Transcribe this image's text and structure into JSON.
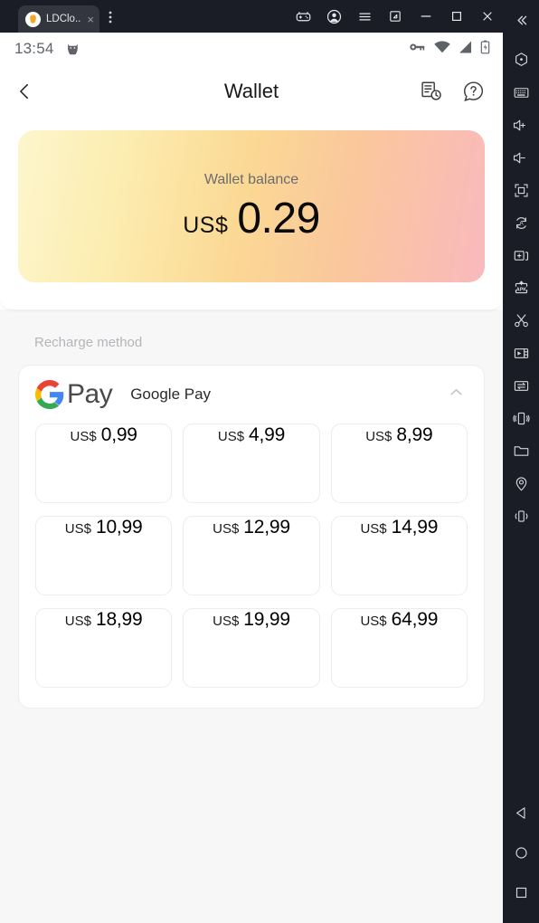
{
  "window": {
    "tab": {
      "label": "LDClo...",
      "icon": "app-icon",
      "close": "×"
    },
    "tab_menu_icon": "kebab-menu-icon",
    "controls": [
      {
        "name": "gamepad-icon",
        "tooltip": "Game controls"
      },
      {
        "name": "account-icon",
        "tooltip": "Account"
      },
      {
        "name": "menu-icon",
        "tooltip": "Menu"
      },
      {
        "name": "resize-icon",
        "tooltip": "Resize"
      },
      {
        "name": "minimize-icon",
        "tooltip": "Minimize"
      },
      {
        "name": "maximize-icon",
        "tooltip": "Maximize"
      },
      {
        "name": "close-icon",
        "tooltip": "Close"
      },
      {
        "name": "collapse-icon",
        "tooltip": "Collapse sidebar"
      }
    ]
  },
  "statusbar": {
    "time": "13:54",
    "left_icon": "cat-icon",
    "right_icons": [
      "vpn-key-icon",
      "wifi-icon",
      "signal-icon",
      "battery-charging-icon"
    ]
  },
  "appbar": {
    "back_icon": "chevron-left-icon",
    "title": "Wallet",
    "actions": [
      {
        "name": "transaction-history-icon"
      },
      {
        "name": "help-icon"
      }
    ]
  },
  "balance": {
    "label": "Wallet balance",
    "currency": "US$",
    "amount": "0.29",
    "gradient_from": "#fdf6cd",
    "gradient_to": "#f9b9bd"
  },
  "recharge": {
    "section_label": "Recharge method",
    "method": {
      "logo": "google-pay-logo",
      "logo_word": "Pay",
      "name": "Google Pay",
      "collapse_icon": "chevron-up-icon",
      "expanded": true
    },
    "currency": "US$",
    "amounts": [
      "0,99",
      "4,99",
      "8,99",
      "10,99",
      "12,99",
      "14,99",
      "18,99",
      "19,99",
      "64,99"
    ]
  },
  "sidebar": {
    "items": [
      {
        "name": "record-macro-icon"
      },
      {
        "name": "keyboard-icon"
      },
      {
        "name": "volume-up-icon"
      },
      {
        "name": "volume-down-icon"
      },
      {
        "name": "fullscreen-icon"
      },
      {
        "name": "auto-rotate-icon"
      },
      {
        "name": "add-window-icon"
      },
      {
        "name": "install-apk-icon"
      },
      {
        "name": "screenshot-icon"
      },
      {
        "name": "video-record-icon"
      },
      {
        "name": "file-transfer-icon"
      },
      {
        "name": "shake-icon"
      },
      {
        "name": "folder-icon"
      },
      {
        "name": "location-icon"
      },
      {
        "name": "vibrate-icon"
      }
    ],
    "nav": [
      {
        "name": "nav-back-icon"
      },
      {
        "name": "nav-home-icon"
      },
      {
        "name": "nav-recents-icon"
      }
    ]
  },
  "colors": {
    "google_red": "#EA4335",
    "google_yellow": "#FBBC05",
    "google_green": "#34A853",
    "google_blue": "#4285F4",
    "chrome_bg": "#1b1d26",
    "page_bg": "#f7f7f8"
  }
}
